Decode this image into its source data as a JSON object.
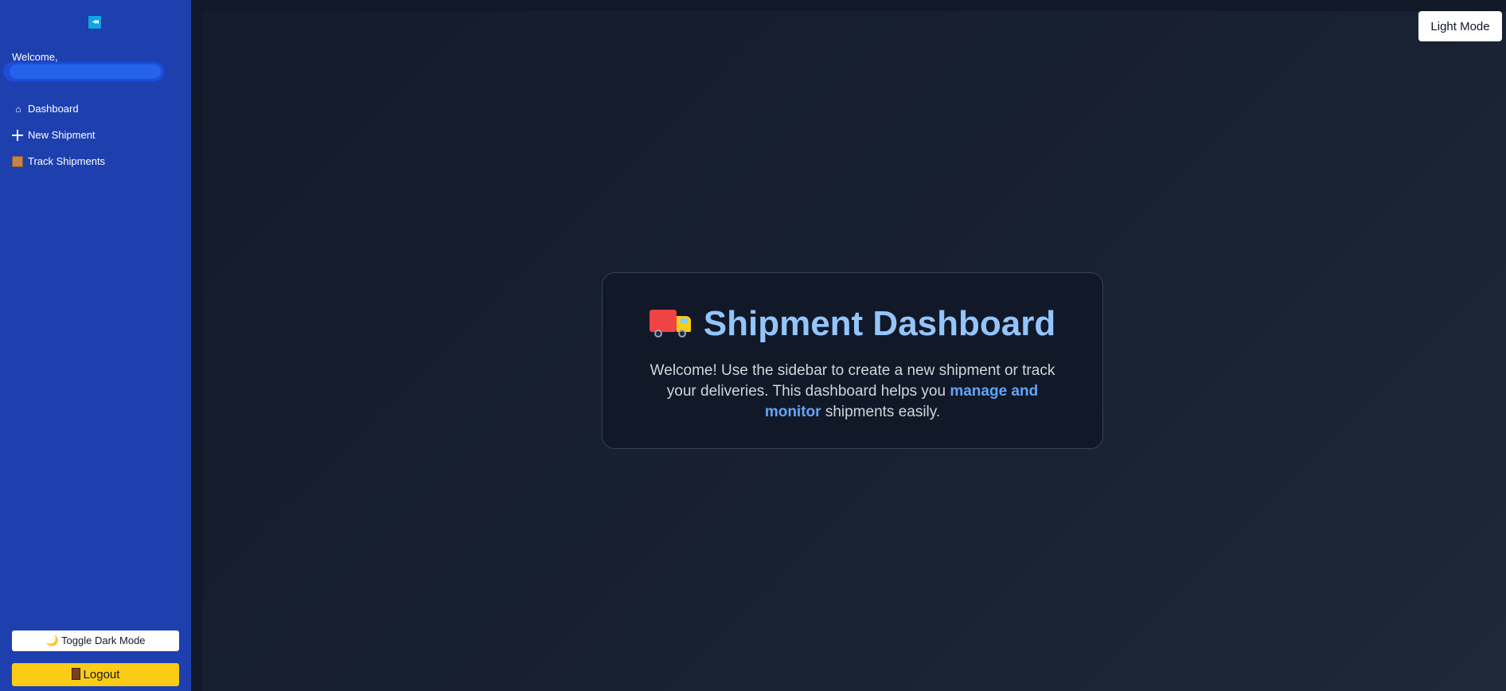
{
  "sidebar": {
    "collapse_glyph": "◂◂",
    "welcome_label": "Welcome,",
    "items": [
      {
        "label": "Dashboard",
        "icon": "home-icon"
      },
      {
        "label": "New Shipment",
        "icon": "plus-icon"
      },
      {
        "label": "Track Shipments",
        "icon": "package-icon"
      }
    ],
    "toggle_dark_label": "Toggle Dark Mode",
    "toggle_dark_icon": "🌙",
    "logout_label": "Logout",
    "logout_icon": "door-icon"
  },
  "header": {
    "light_mode_label": "Light Mode"
  },
  "card": {
    "title": "Shipment Dashboard",
    "title_icon": "truck-icon",
    "text_before": "Welcome! Use the sidebar to create a new shipment or track your deliveries. This dashboard helps you ",
    "text_highlight": "manage and monitor",
    "text_after": " shipments easily."
  },
  "colors": {
    "sidebar_bg": "#1e40af",
    "main_bg": "#111827",
    "title": "#93c5fd",
    "highlight": "#60a5fa",
    "logout_bg": "#facc15"
  }
}
